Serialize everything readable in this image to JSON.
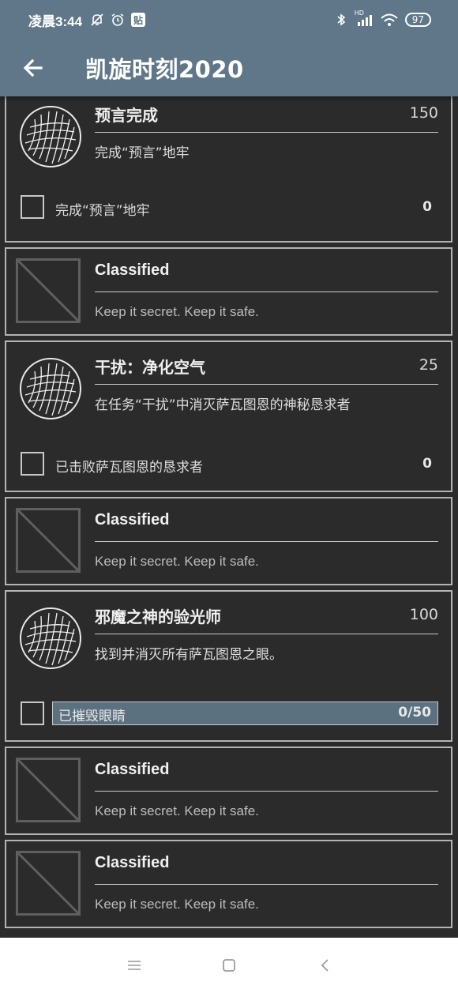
{
  "status_bar": {
    "time": "凌晨3:44",
    "sticker": "贴",
    "battery": "97",
    "signal_label": "HD",
    "icons": [
      "bell-off-icon",
      "alarm-icon",
      "sticker-icon",
      "bluetooth-icon",
      "signal-icon",
      "wifi-icon",
      "battery-icon"
    ]
  },
  "app_bar": {
    "title": "凯旋时刻2020",
    "back_icon": "arrow-left-icon"
  },
  "colors": {
    "app_bar": "#5f7788",
    "background": "#2b2b2b",
    "card_border": "#b4b4b4",
    "progress_fill": "#5c7180"
  },
  "triumphs": [
    {
      "type": "triumph",
      "name": "预言完成",
      "points": "150",
      "description": "完成“预言”地牢",
      "icon": "emblem-icon",
      "objective": {
        "label": "完成“预言”地牢",
        "value": "0",
        "kind": "checkbox"
      }
    },
    {
      "type": "classified",
      "name": "Classified",
      "description": "Keep it secret.  Keep it safe.",
      "icon": "classified-placeholder-icon"
    },
    {
      "type": "triumph",
      "name": "干扰：净化空气",
      "points": "25",
      "description": "在任务“干扰”中消灭萨瓦图恩的神秘恳求者",
      "icon": "emblem-icon",
      "objective": {
        "label": "已击败萨瓦图恩的恳求者",
        "value": "0",
        "kind": "checkbox"
      }
    },
    {
      "type": "classified",
      "name": "Classified",
      "description": "Keep it secret.  Keep it safe.",
      "icon": "classified-placeholder-icon"
    },
    {
      "type": "triumph",
      "name": "邪魔之神的验光师",
      "points": "100",
      "description": "找到并消灭所有萨瓦图恩之眼。",
      "icon": "emblem-icon",
      "objective": {
        "label": "已摧毁眼睛",
        "value": "0/50",
        "kind": "progress",
        "progress_fraction": 1.0
      }
    },
    {
      "type": "classified",
      "name": "Classified",
      "description": "Keep it secret.  Keep it safe.",
      "icon": "classified-placeholder-icon"
    },
    {
      "type": "classified",
      "name": "Classified",
      "description": "Keep it secret.  Keep it safe.",
      "icon": "classified-placeholder-icon"
    }
  ],
  "nav_bar": {
    "buttons": [
      "menu-icon",
      "home-square-icon",
      "back-chevron-icon"
    ]
  }
}
